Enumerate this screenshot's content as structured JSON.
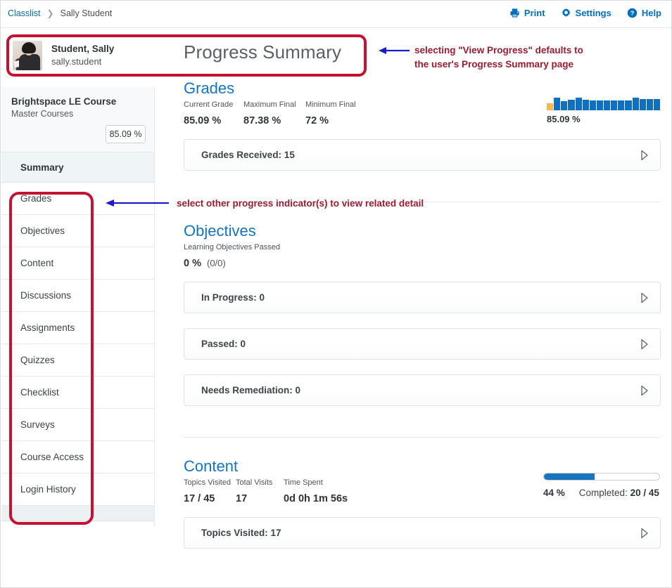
{
  "breadcrumb": {
    "root": "Classlist",
    "separator": "❯",
    "current": "Sally Student"
  },
  "toolbar": {
    "print": "Print",
    "settings": "Settings",
    "help": "Help"
  },
  "student": {
    "name": "Student, Sally",
    "username": "sally.student",
    "page_title": "Progress Summary"
  },
  "sidebar": {
    "course_title": "Brightspace LE Course",
    "course_sub": "Master Courses",
    "course_grade": "85.09 %",
    "summary_label": "Summary",
    "items": [
      {
        "label": "Grades"
      },
      {
        "label": "Objectives"
      },
      {
        "label": "Content"
      },
      {
        "label": "Discussions"
      },
      {
        "label": "Assignments"
      },
      {
        "label": "Quizzes"
      },
      {
        "label": "Checklist"
      },
      {
        "label": "Surveys"
      },
      {
        "label": "Course Access"
      },
      {
        "label": "Login History"
      }
    ]
  },
  "grades": {
    "title": "Grades",
    "stats": [
      {
        "label": "Current Grade",
        "value": "85.09 %"
      },
      {
        "label": "Maximum Final",
        "value": "87.38 %"
      },
      {
        "label": "Minimum Final",
        "value": "72 %"
      }
    ],
    "spark_label": "85.09 %",
    "panel": {
      "label": "Grades Received: 15"
    }
  },
  "objectives": {
    "title": "Objectives",
    "stat_label": "Learning Objectives Passed",
    "stat_value": "0 %",
    "stat_fraction": "(0/0)",
    "panels": [
      {
        "label": "In Progress: 0"
      },
      {
        "label": "Passed: 0"
      },
      {
        "label": "Needs Remediation: 0"
      }
    ]
  },
  "content": {
    "title": "Content",
    "stats": [
      {
        "label": "Topics Visited",
        "value": "17 / 45"
      },
      {
        "label": "Total Visits",
        "value": "17"
      },
      {
        "label": "Time Spent",
        "value": "0d 0h 1m 56s"
      }
    ],
    "progress_pct": "44 %",
    "progress_completed_prefix": "Completed: ",
    "progress_completed_value": "20 / 45",
    "progress_fill_percent": 44,
    "panel": {
      "label": "Topics Visited: 17"
    }
  },
  "annotations": [
    {
      "text": "selecting \"View Progress\" defaults to\nthe user's Progress Summary page"
    },
    {
      "text": "select other progress indicator(s) to view related detail"
    }
  ],
  "chart_data": {
    "type": "bar",
    "title": "Grades distribution sparkline",
    "categories": [
      "1",
      "2",
      "3",
      "4",
      "5",
      "6",
      "7",
      "8",
      "9",
      "10",
      "11",
      "12",
      "13",
      "14",
      "15",
      "16"
    ],
    "values": [
      55,
      100,
      72,
      85,
      100,
      83,
      78,
      78,
      78,
      78,
      78,
      78,
      100,
      88,
      88,
      88
    ],
    "colors": [
      "#f6b656",
      "#0f6fc0",
      "#0f6fc0",
      "#0f6fc0",
      "#0f6fc0",
      "#0f6fc0",
      "#0f6fc0",
      "#0f6fc0",
      "#0f6fc0",
      "#0f6fc0",
      "#0f6fc0",
      "#0f6fc0",
      "#0f6fc0",
      "#0f6fc0",
      "#0f6fc0",
      "#0f6fc0"
    ],
    "ylim": [
      0,
      100
    ],
    "grid": false,
    "legend": "none",
    "annotation": "85.09 %"
  },
  "colors": {
    "accent_blue": "#1274c6",
    "link_blue": "#0069a6",
    "bar_blue": "#0f6fc0",
    "bar_orange": "#f6b656",
    "annotation_red": "#9b1b30",
    "highlight_red": "#c41230",
    "arrow_blue": "#1a1acc"
  }
}
